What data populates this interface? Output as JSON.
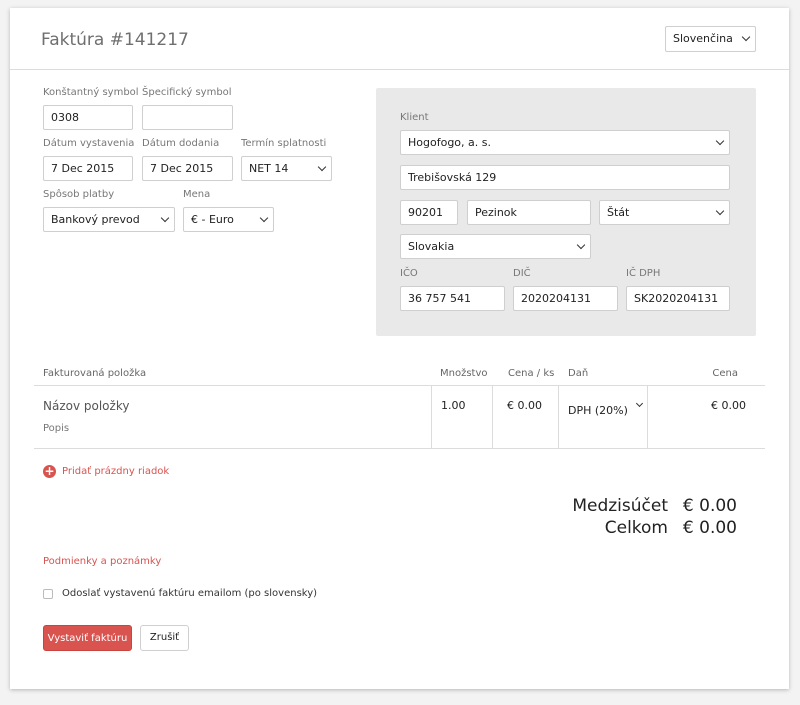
{
  "header": {
    "title": "Faktúra #141217",
    "language": "Slovenčina"
  },
  "invoice": {
    "constant_symbol": {
      "label": "Konštantný symbol",
      "value": "0308"
    },
    "specific_symbol": {
      "label": "Špecifický symbol",
      "value": ""
    },
    "issue_date": {
      "label": "Dátum vystavenia",
      "value": "7 Dec 2015"
    },
    "delivery_date": {
      "label": "Dátum dodania",
      "value": "7 Dec 2015"
    },
    "due_term": {
      "label": "Termín splatnosti",
      "value": "NET 14"
    },
    "payment_method": {
      "label": "Spôsob platby",
      "value": "Bankový prevod"
    },
    "currency": {
      "label": "Mena",
      "value": "€ - Euro"
    }
  },
  "client": {
    "label": "Klient",
    "name": "Hogofogo, a. s.",
    "street": "Trebišovská 129",
    "zip": "90201",
    "city": "Pezinok",
    "state": "Štát",
    "country": "Slovakia",
    "ico": {
      "label": "IČO",
      "value": "36 757 541"
    },
    "dic": {
      "label": "DIČ",
      "value": "2020204131"
    },
    "ic_dph": {
      "label": "IČ DPH",
      "value": "SK2020204131"
    }
  },
  "items_table": {
    "headers": {
      "item": "Fakturovaná položka",
      "qty": "Množstvo",
      "unit_price": "Cena / ks",
      "tax": "Daň",
      "price": "Cena"
    },
    "rows": [
      {
        "name": "Názov položky",
        "description": "Popis",
        "qty": "1.00",
        "unit_price": "€ 0.00",
        "tax": "DPH (20%)",
        "price": "€ 0.00"
      }
    ],
    "add_row_label": "Pridať prázdny riadok"
  },
  "totals": {
    "subtotal_label": "Medzisúčet",
    "subtotal_value": "€ 0.00",
    "total_label": "Celkom",
    "total_value": "€ 0.00"
  },
  "notes_link": "Podmienky a poznámky",
  "email_option": {
    "label": "Odoslať vystavenú faktúru emailom (po slovensky)",
    "checked": false
  },
  "actions": {
    "submit": "Vystaviť faktúru",
    "cancel": "Zrušiť"
  },
  "colors": {
    "accent": "#d9534f",
    "client_bg": "#e9e9e9"
  }
}
